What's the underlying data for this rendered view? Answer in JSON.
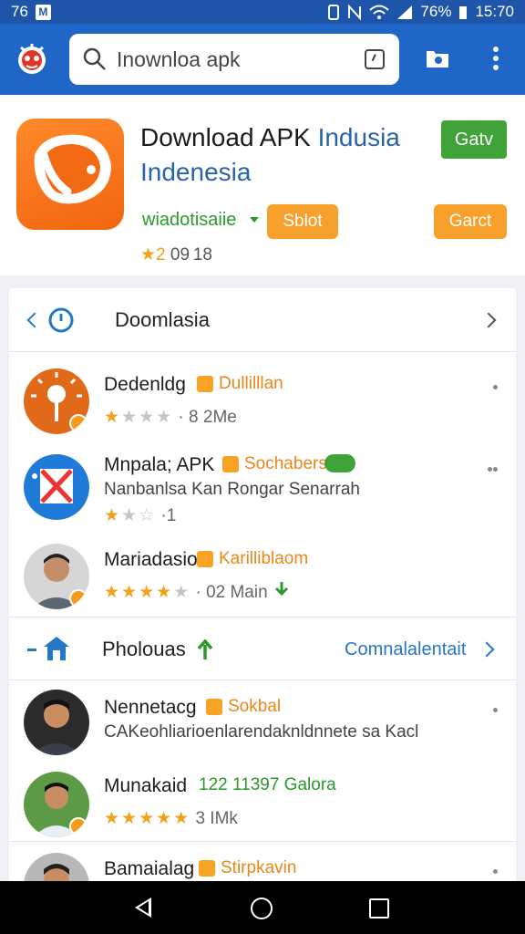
{
  "status_bar": {
    "time": "15:70",
    "battery": "76%",
    "left_text": "76",
    "notif_letter": "M"
  },
  "search": {
    "value": "Inownloa apk"
  },
  "hero": {
    "title_part1": "Download APK ",
    "title_part2": "Indusia Indenesia",
    "green_button": "Gatv",
    "developer": "wiadotisaiie",
    "select_button": "Sblot",
    "get_button": "Garct",
    "meta_star": "★2",
    "meta_text": " 09 18"
  },
  "section1": {
    "title": "Doomlasia"
  },
  "section2": {
    "title": "Pholouas",
    "link": "Comnalalentait"
  },
  "rows": [
    {
      "name": "Dedenldg",
      "tag": "Dullilllan",
      "rating_stars_on": 1,
      "rating_stars_off": 3,
      "rating_text": "8 2Me",
      "avatar_color": "#e06a1a"
    },
    {
      "name": "Mnpala; APK",
      "tag": "Sochabers",
      "desc": "Nanbanlsa Kan Rongar Senarrah",
      "rating_stars_on": 1,
      "rating_stars_off": 2,
      "rating_text": "1",
      "avatar_color": "#1f7ad8"
    },
    {
      "name": "Mariadasio",
      "tag": "Karilliblaom",
      "rating_stars_on": 4,
      "rating_stars_off": 1,
      "rating_text": "02 Main",
      "avatar_color": "#c9c9c9"
    },
    {
      "name": "Nennetacg",
      "tag": "Sokbal",
      "desc": "CAKeohliarioenlarendaknldnnete sa Kacl",
      "avatar_color": "#2b2b2b"
    },
    {
      "name": "Munakaid",
      "tag": "122 11397 Galora",
      "rating_stars_on": 5,
      "rating_stars_off": 0,
      "rating_text": "3 IMk",
      "avatar_color": "#5c9a45"
    },
    {
      "name": "Bamaialag",
      "tag": "Stirpkavin",
      "avatar_color": "#b8b8b8"
    }
  ],
  "colors": {
    "appbar": "#1f66c6",
    "statusbar": "#1f55a8",
    "accent_green": "#3fa33a",
    "accent_orange": "#f8a02c",
    "link_blue": "#2478c6"
  }
}
